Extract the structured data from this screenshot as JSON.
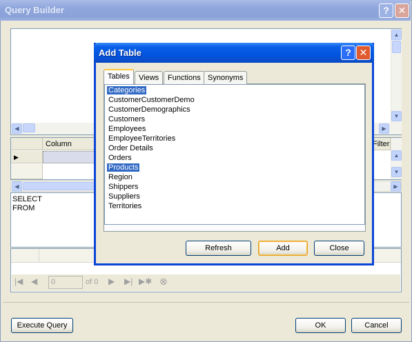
{
  "query_builder": {
    "title": "Query Builder",
    "grid_columns": [
      "Column",
      "Filter"
    ],
    "sql_lines": [
      "SELECT",
      "FROM"
    ],
    "nav": {
      "position": "0",
      "of_label": "of 0"
    },
    "execute_label": "Execute Query",
    "ok_label": "OK",
    "cancel_label": "Cancel"
  },
  "add_table": {
    "title": "Add Table",
    "tabs": [
      "Tables",
      "Views",
      "Functions",
      "Synonyms"
    ],
    "active_tab": "Tables",
    "tables": [
      {
        "name": "Categories",
        "selected": true
      },
      {
        "name": "CustomerCustomerDemo",
        "selected": false
      },
      {
        "name": "CustomerDemographics",
        "selected": false
      },
      {
        "name": "Customers",
        "selected": false
      },
      {
        "name": "Employees",
        "selected": false
      },
      {
        "name": "EmployeeTerritories",
        "selected": false
      },
      {
        "name": "Order Details",
        "selected": false
      },
      {
        "name": "Orders",
        "selected": false
      },
      {
        "name": "Products",
        "selected": true
      },
      {
        "name": "Region",
        "selected": false
      },
      {
        "name": "Shippers",
        "selected": false
      },
      {
        "name": "Suppliers",
        "selected": false
      },
      {
        "name": "Territories",
        "selected": false
      }
    ],
    "refresh_label": "Refresh",
    "add_label": "Add",
    "close_label": "Close"
  },
  "icons": {
    "help": "?",
    "close": "✕",
    "up": "▲",
    "down": "▼",
    "left": "◀",
    "right": "▶",
    "row_pointer": "▶",
    "first": "|◀",
    "prev": "◀",
    "next": "▶",
    "last": "▶|",
    "new": "▶✱",
    "stop": "⊗"
  },
  "colors": {
    "xp_blue_title": "#0155df",
    "selection": "#316ac5",
    "window_face": "#ece9d8"
  }
}
